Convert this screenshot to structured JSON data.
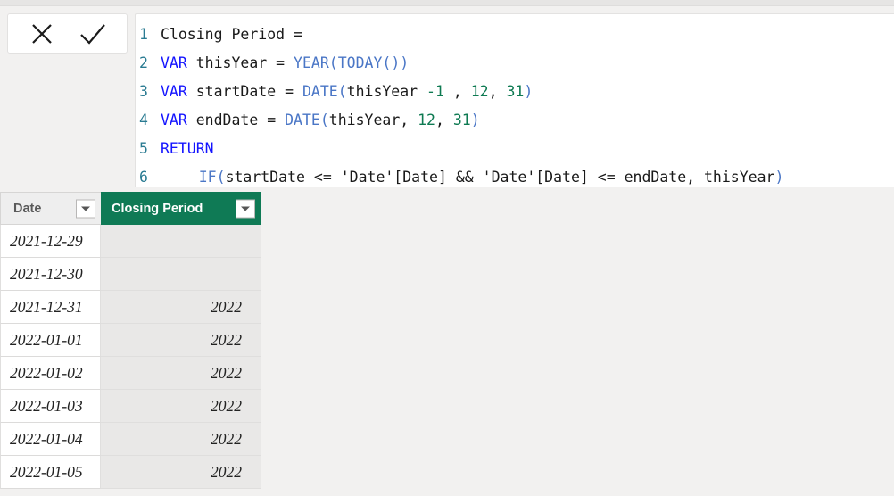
{
  "toolbar": {
    "cancel_label": "Cancel",
    "commit_label": "Commit",
    "cancel_icon": "close-icon",
    "commit_icon": "checkmark-icon"
  },
  "formula": {
    "lines": [
      {
        "number": "1",
        "tokens": [
          {
            "t": "Closing Period =",
            "c": "tk-pl"
          }
        ]
      },
      {
        "number": "2",
        "tokens": [
          {
            "t": "VAR",
            "c": "tk-kw"
          },
          {
            "t": " thisYear = ",
            "c": "tk-pl"
          },
          {
            "t": "YEAR",
            "c": "tk-fn"
          },
          {
            "t": "(",
            "c": "tk-fn"
          },
          {
            "t": "TODAY",
            "c": "tk-fn"
          },
          {
            "t": "())",
            "c": "tk-fn"
          }
        ]
      },
      {
        "number": "3",
        "tokens": [
          {
            "t": "VAR",
            "c": "tk-kw"
          },
          {
            "t": " startDate = ",
            "c": "tk-pl"
          },
          {
            "t": "DATE",
            "c": "tk-fn"
          },
          {
            "t": "(",
            "c": "tk-fn"
          },
          {
            "t": "thisYear ",
            "c": "tk-pl"
          },
          {
            "t": "-1",
            "c": "tk-num"
          },
          {
            "t": " , ",
            "c": "tk-pl"
          },
          {
            "t": "12",
            "c": "tk-num"
          },
          {
            "t": ", ",
            "c": "tk-pl"
          },
          {
            "t": "31",
            "c": "tk-num"
          },
          {
            "t": ")",
            "c": "tk-fn"
          }
        ]
      },
      {
        "number": "4",
        "tokens": [
          {
            "t": "VAR",
            "c": "tk-kw"
          },
          {
            "t": " endDate = ",
            "c": "tk-pl"
          },
          {
            "t": "DATE",
            "c": "tk-fn"
          },
          {
            "t": "(",
            "c": "tk-fn"
          },
          {
            "t": "thisYear, ",
            "c": "tk-pl"
          },
          {
            "t": "12",
            "c": "tk-num"
          },
          {
            "t": ", ",
            "c": "tk-pl"
          },
          {
            "t": "31",
            "c": "tk-num"
          },
          {
            "t": ")",
            "c": "tk-fn"
          }
        ]
      },
      {
        "number": "5",
        "tokens": [
          {
            "t": "RETURN",
            "c": "tk-kw"
          }
        ]
      },
      {
        "number": "6",
        "caret": true,
        "tokens": [
          {
            "t": "    ",
            "c": "tk-pl"
          },
          {
            "t": "IF",
            "c": "tk-fn"
          },
          {
            "t": "(",
            "c": "tk-fn"
          },
          {
            "t": "startDate <= 'Date'[Date] && 'Date'[Date] <= endDate, thisYear",
            "c": "tk-pl"
          },
          {
            "t": ")",
            "c": "tk-fn"
          }
        ]
      }
    ],
    "plain_text": "Closing Period =\nVAR thisYear = YEAR(TODAY())\nVAR startDate = DATE(thisYear -1 , 12, 31)\nVAR endDate = DATE(thisYear, 12, 31)\nRETURN\n    IF(startDate <= 'Date'[Date] && 'Date'[Date] <= endDate, thisYear)"
  },
  "table": {
    "columns": [
      {
        "label": "Date",
        "key": "date",
        "filter_icon": "chevron-down-icon",
        "highlighted": false
      },
      {
        "label": "Closing Period",
        "key": "closing_period",
        "filter_icon": "chevron-down-icon",
        "highlighted": true
      }
    ],
    "rows": [
      {
        "date": "2021-12-29",
        "closing_period": ""
      },
      {
        "date": "2021-12-30",
        "closing_period": ""
      },
      {
        "date": "2021-12-31",
        "closing_period": "2022"
      },
      {
        "date": "2022-01-01",
        "closing_period": "2022"
      },
      {
        "date": "2022-01-02",
        "closing_period": "2022"
      },
      {
        "date": "2022-01-03",
        "closing_period": "2022"
      },
      {
        "date": "2022-01-04",
        "closing_period": "2022"
      },
      {
        "date": "2022-01-05",
        "closing_period": "2022"
      }
    ]
  },
  "colors": {
    "header_accent": "#0f7a55",
    "keyword": "#1414ff",
    "function": "#4a76c6",
    "number": "#0e7a52",
    "line_number": "#2a7b92",
    "page_background": "#f2f1f0"
  }
}
